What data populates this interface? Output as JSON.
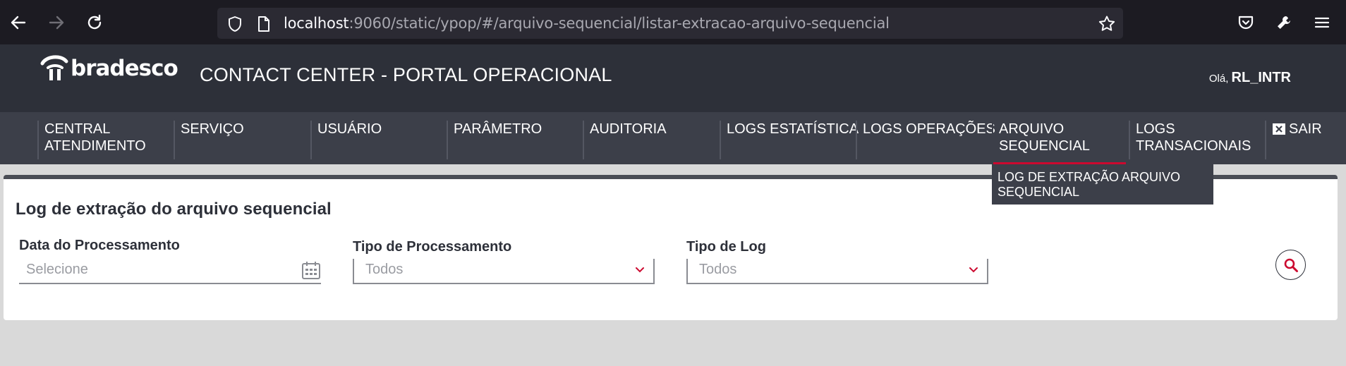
{
  "browser": {
    "url_host": "localhost",
    "url_rest": ":9060/static/ypop/#/arquivo-sequencial/listar-extracao-arquivo-sequencial"
  },
  "header": {
    "brand": "bradesco",
    "title": "CONTACT CENTER - PORTAL OPERACIONAL",
    "greeting_prefix": "Olá,",
    "user": "RL_INTR"
  },
  "nav": {
    "items": [
      {
        "line1": "CENTRAL",
        "line2": "ATENDIMENTO"
      },
      {
        "line1": "SERVIÇO",
        "line2": ""
      },
      {
        "line1": "USUÁRIO",
        "line2": ""
      },
      {
        "line1": "PARÂMETRO",
        "line2": ""
      },
      {
        "line1": "AUDITORIA",
        "line2": ""
      },
      {
        "line1": "LOGS ESTATÍSTICA",
        "line2": ""
      },
      {
        "line1": "LOGS OPERAÇÕES",
        "line2": ""
      },
      {
        "line1": "ARQUIVO",
        "line2": "SEQUENCIAL"
      },
      {
        "line1": "LOGS",
        "line2": "TRANSACIONAIS"
      }
    ],
    "logout": "SAIR",
    "submenu_line1": "LOG DE EXTRAÇÃO ARQUIVO",
    "submenu_line2": "SEQUENCIAL"
  },
  "page": {
    "title": "Log de extração do arquivo sequencial",
    "filters": {
      "date_label": "Data do Processamento",
      "date_placeholder": "Selecione",
      "processing_type_label": "Tipo de Processamento",
      "processing_type_value": "Todos",
      "log_type_label": "Tipo de Log",
      "log_type_value": "Todos"
    }
  },
  "colors": {
    "accent": "#cc092f",
    "header_bg": "#2d3039",
    "nav_bg": "#3c3f49"
  }
}
